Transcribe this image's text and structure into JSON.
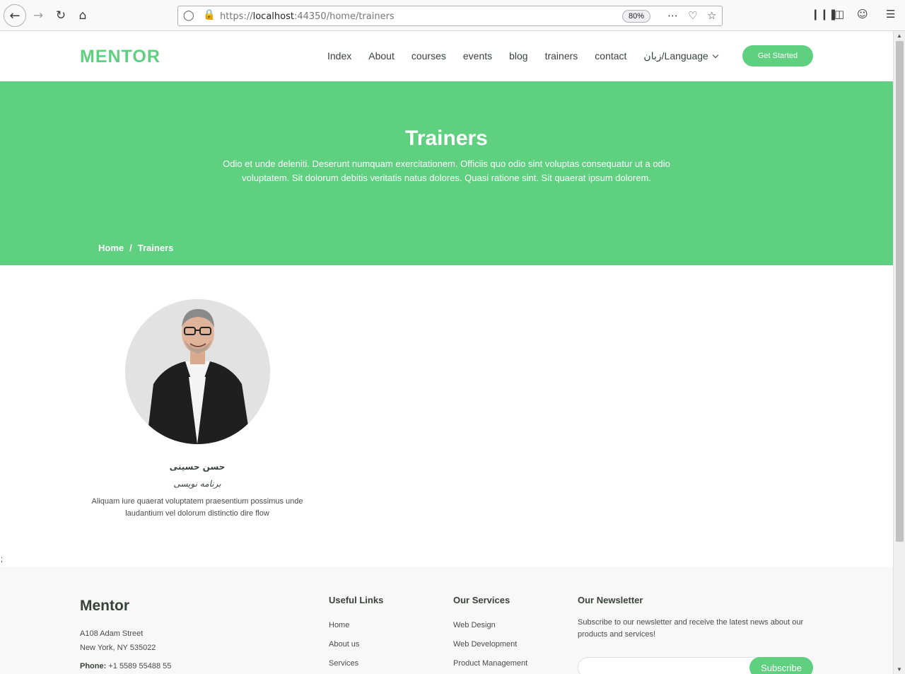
{
  "browser": {
    "url_prefix": "https://",
    "url_host": "localhost",
    "url_rest": ":44350/home/trainers",
    "zoom": "80%"
  },
  "header": {
    "logo": "MENTOR",
    "menu": [
      "Index",
      "About",
      "courses",
      "events",
      "blog",
      "trainers",
      "contact"
    ],
    "language": "زبان/Language",
    "cta": "Get Started"
  },
  "hero": {
    "title": "Trainers",
    "subtitle": "Odio et unde deleniti. Deserunt numquam exercitationem. Officiis quo odio sint voluptas consequatur ut a odio voluptatem. Sit dolorum debitis veritatis natus dolores. Quasi ratione sint. Sit quaerat ipsum dolorem.",
    "breadcrumb": [
      "Home",
      "/",
      "Trainers"
    ]
  },
  "trainer": {
    "name": "حسن حسینی",
    "role": "برنامه نویسی",
    "description": "Aliquam iure quaerat voluptatem praesentium possimus unde laudantium vel dolorum distinctio dire flow"
  },
  "stray_text": ";",
  "footer": {
    "brand": "Mentor",
    "address_line1": "A108 Adam Street",
    "address_line2": "New York, NY 535022",
    "phone_label": "Phone:",
    "phone_value": "+1 5589 55488 55",
    "useful_links_title": "Useful Links",
    "useful_links": [
      "Home",
      "About us",
      "Services"
    ],
    "services_title": "Our Services",
    "services": [
      "Web Design",
      "Web Development",
      "Product Management"
    ],
    "newsletter_title": "Our Newsletter",
    "newsletter_text": "Subscribe to our newsletter and receive the latest news about our products and services!",
    "subscribe": "Subscribe"
  },
  "colors": {
    "accent": "#5fcf80",
    "text": "#37423b"
  }
}
